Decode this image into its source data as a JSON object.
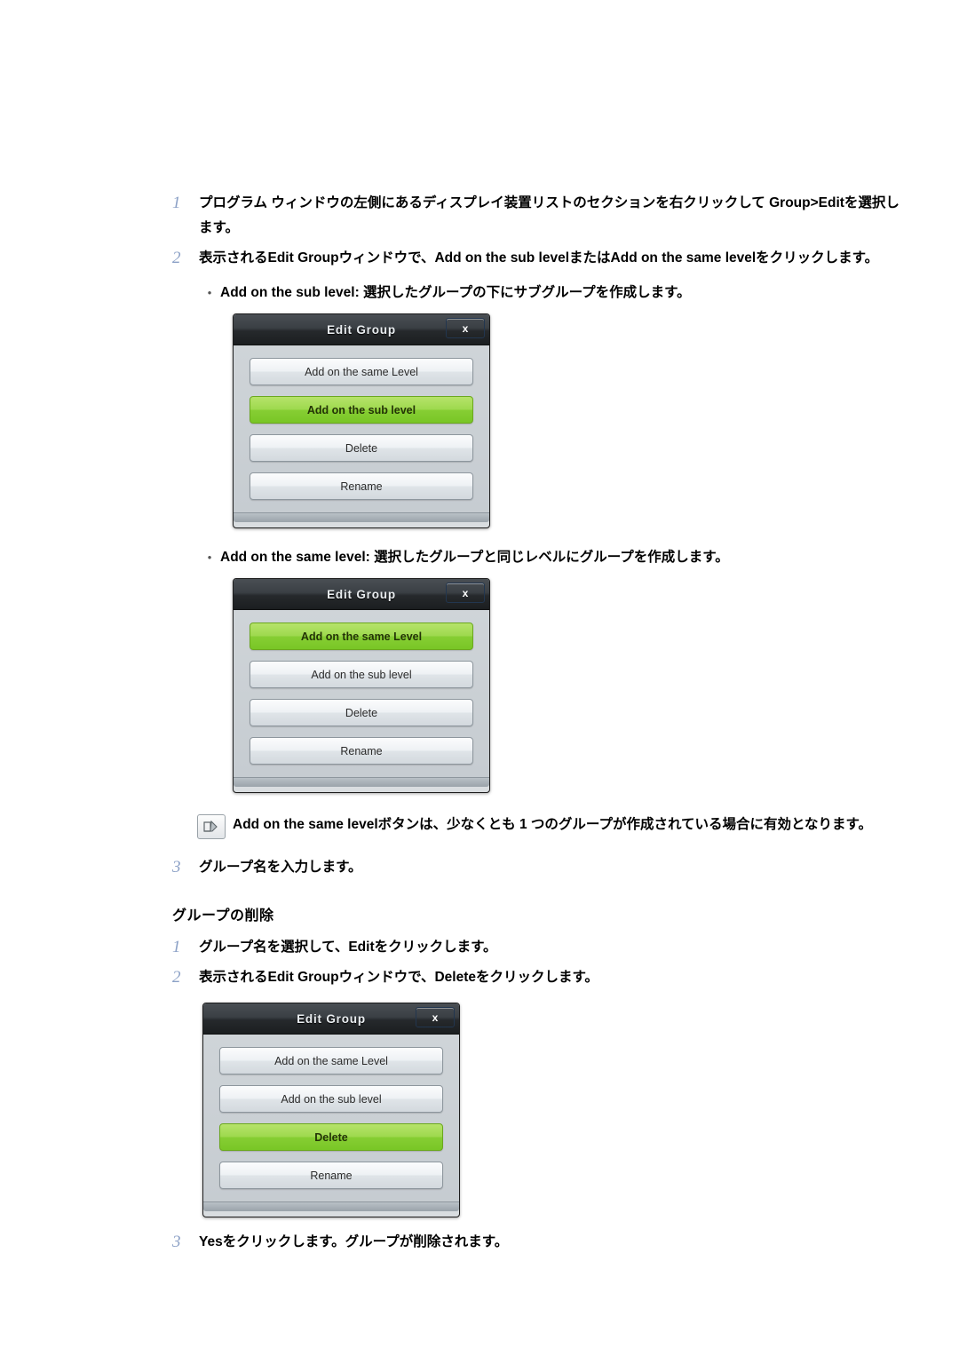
{
  "steps_group_create": [
    {
      "num": "1",
      "text": "プログラム ウィンドウの左側にあるディスプレイ装置リストのセクションを右クリックして Group>Editを選択します。"
    },
    {
      "num": "2",
      "text": "表示されるEdit Groupウィンドウで、Add on the sub levelまたはAdd on the same levelをクリックします。"
    }
  ],
  "bullets": [
    {
      "marker": "•",
      "text": "Add on the sub level: 選択したグループの下にサブグループを作成します。"
    },
    {
      "marker": "•",
      "text": "Add on the same level: 選択したグループと同じレベルにグループを作成します。"
    }
  ],
  "dialogs": {
    "sub_level": {
      "title": "Edit Group",
      "close_label": "x",
      "buttons": [
        {
          "label": "Add on the same Level",
          "highlighted": false
        },
        {
          "label": "Add on the sub level",
          "highlighted": true
        },
        {
          "label": "Delete",
          "highlighted": false
        },
        {
          "label": "Rename",
          "highlighted": false
        }
      ]
    },
    "same_level": {
      "title": "Edit Group",
      "close_label": "x",
      "buttons": [
        {
          "label": "Add on the same Level",
          "highlighted": true
        },
        {
          "label": "Add on the sub level",
          "highlighted": false
        },
        {
          "label": "Delete",
          "highlighted": false
        },
        {
          "label": "Rename",
          "highlighted": false
        }
      ]
    },
    "delete": {
      "title": "Edit Group",
      "close_label": "x",
      "buttons": [
        {
          "label": "Add on the same Level",
          "highlighted": false
        },
        {
          "label": "Add on the sub level",
          "highlighted": false
        },
        {
          "label": "Delete",
          "highlighted": true
        },
        {
          "label": "Rename",
          "highlighted": false
        }
      ]
    }
  },
  "note": {
    "icon": "note-pencil-icon",
    "text": "Add on the same levelボタンは、少なくとも 1 つのグループが作成されている場合に有効となります。"
  },
  "step_3_create": {
    "num": "3",
    "text": "グループ名を入力します。"
  },
  "section_delete": {
    "heading": "グループの削除"
  },
  "steps_group_delete": [
    {
      "num": "1",
      "text": "グループ名を選択して、Editをクリックします。"
    },
    {
      "num": "2",
      "text": "表示されるEdit Groupウィンドウで、Deleteをクリックします。"
    },
    {
      "num": "3",
      "text": "Yesをクリックします。グループが削除されます。"
    }
  ],
  "colors": {
    "step_number": "#8ba0c6",
    "highlight_green": "#8fd13c",
    "dialog_titlebar": "#2b2f33",
    "close_button": "#3c5f8d"
  }
}
